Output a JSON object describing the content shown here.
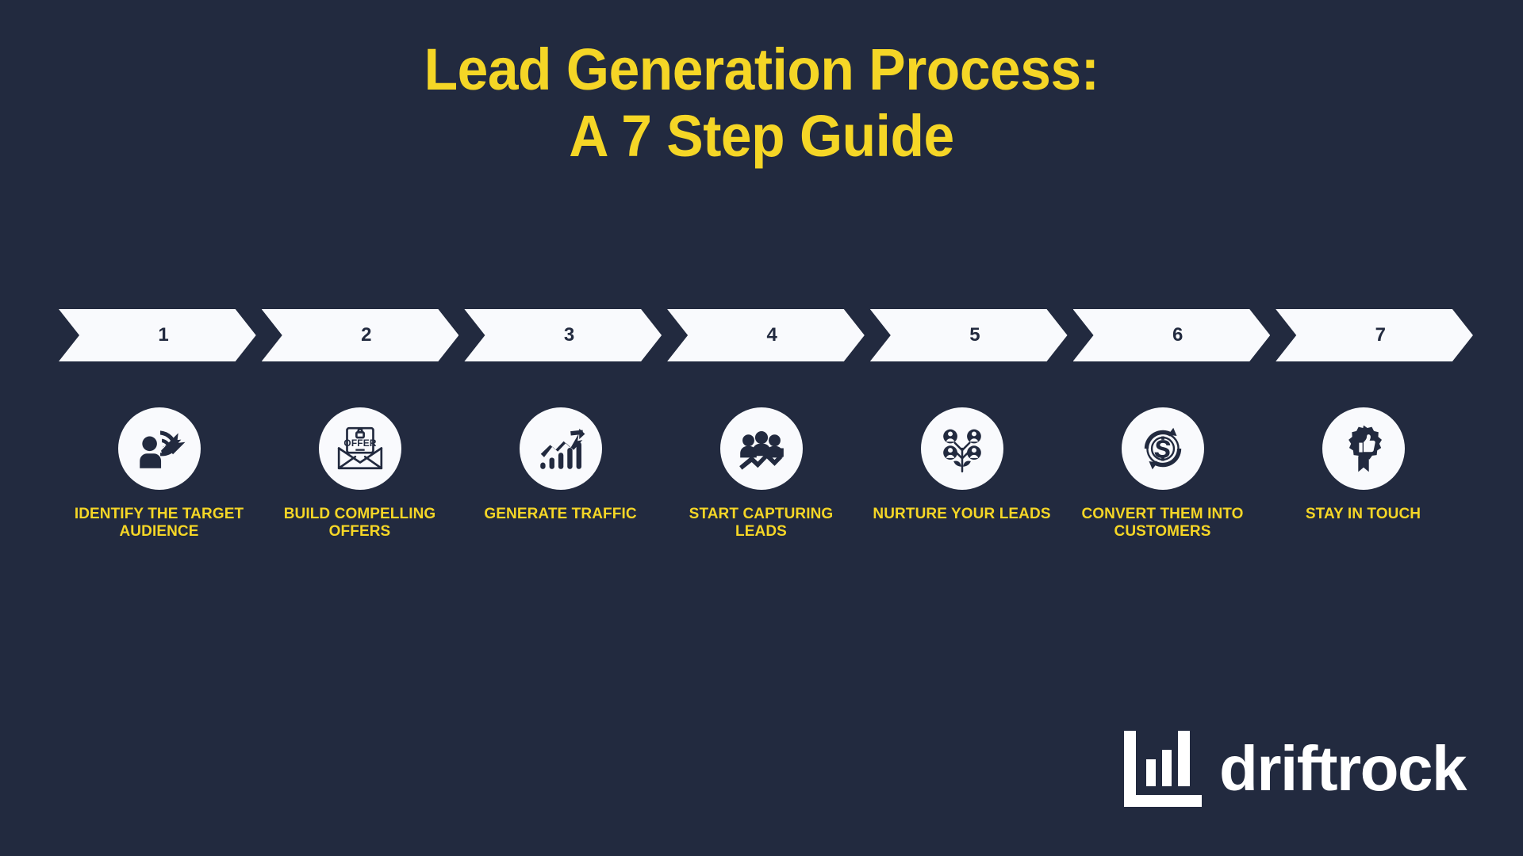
{
  "colors": {
    "background": "#222a3f",
    "accent_yellow": "#f5d626",
    "panel_white": "#f9fafd",
    "logo_white": "#ffffff"
  },
  "title": {
    "line1": "Lead Generation Process:",
    "line2": "A 7 Step Guide"
  },
  "steps": [
    {
      "number": "1",
      "label": "Identify the target audience",
      "icon": "target-audience-icon"
    },
    {
      "number": "2",
      "label": "Build compelling offers",
      "icon": "offer-envelope-icon"
    },
    {
      "number": "3",
      "label": "Generate traffic",
      "icon": "growth-chart-icon"
    },
    {
      "number": "4",
      "label": "Start capturing leads",
      "icon": "people-growth-icon"
    },
    {
      "number": "5",
      "label": "Nurture your leads",
      "icon": "lead-nurture-plant-icon"
    },
    {
      "number": "6",
      "label": "Convert them into customers",
      "icon": "dollar-conversion-icon"
    },
    {
      "number": "7",
      "label": "Stay in touch",
      "icon": "thumbs-up-award-icon"
    }
  ],
  "logo": {
    "wordmark": "driftrock",
    "mark": "driftrock-bar-chart-mark"
  }
}
